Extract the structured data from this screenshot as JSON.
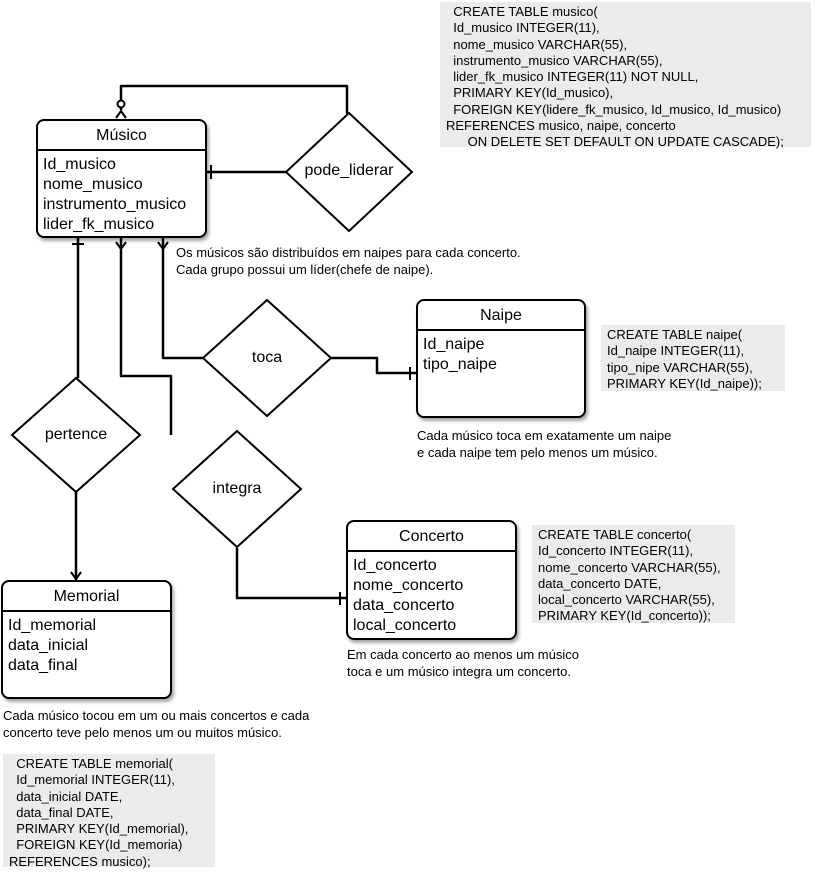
{
  "entities": {
    "musico": {
      "name": "Músico",
      "attributes": [
        "Id_musico",
        "nome_musico",
        "instrumento_musico",
        "lider_fk_musico"
      ]
    },
    "naipe": {
      "name": "Naipe",
      "attributes": [
        "Id_naipe",
        "tipo_naipe"
      ]
    },
    "concerto": {
      "name": "Concerto",
      "attributes": [
        "Id_concerto",
        "nome_concerto",
        "data_concerto",
        "local_concerto"
      ]
    },
    "memorial": {
      "name": "Memorial",
      "attributes": [
        "Id_memorial",
        "data_inicial",
        "data_final"
      ]
    }
  },
  "relationships": {
    "pode_liderar": "pode_liderar",
    "toca": "toca",
    "pertence": "pertence",
    "integra": "integra"
  },
  "sql": {
    "musico": "  CREATE TABLE musico(\n  Id_musico INTEGER(11),\n  nome_musico VARCHAR(55),\n  instrumento_musico VARCHAR(55),\n  lider_fk_musico INTEGER(11) NOT NULL,\n  PRIMARY KEY(Id_musico),\n  FOREIGN KEY(lidere_fk_musico, Id_musico, Id_musico)\nREFERENCES musico, naipe, concerto\n      ON DELETE SET DEFAULT ON UPDATE CASCADE);",
    "naipe": "CREATE TABLE naipe(\nId_naipe INTEGER(11),\ntipo_nipe VARCHAR(55),\nPRIMARY KEY(Id_naipe));",
    "concerto": "CREATE TABLE concerto(\nId_concerto INTEGER(11),\nnome_concerto VARCHAR(55),\ndata_concerto DATE,\nlocal_concerto VARCHAR(55),\nPRIMARY KEY(Id_concerto));",
    "memorial": "  CREATE TABLE memorial(\n  Id_memorial INTEGER(11),\n  data_inicial DATE,\n  data_final DATE,\n  PRIMARY KEY(Id_memorial),\n  FOREIGN KEY(Id_memoria)\nREFERENCES musico);"
  },
  "notes": {
    "naipes": "Os músicos são distribuídos em naipes para cada concerto.\nCada grupo possui um líder(chefe de naipe).",
    "toca": "Cada músico toca em exatamente um naipe\ne cada naipe tem pelo menos um músico.",
    "integra": "Em cada concerto ao menos um músico\ntoca e um músico integra um concerto.",
    "memorial": "Cada músico tocou em um ou mais concertos e cada\nconcerto teve pelo menos um ou muitos músico."
  }
}
